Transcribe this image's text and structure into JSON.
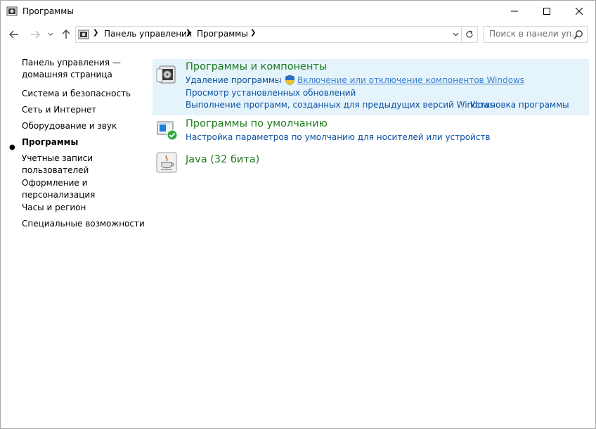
{
  "window": {
    "title": "Программы"
  },
  "navigation": {
    "breadcrumb": [
      "Панель управления",
      "Программы"
    ],
    "search_placeholder": "Поиск в панели уп..."
  },
  "sidebar": {
    "home_label": "Панель управления — домашняя страница",
    "home_line1": "Панель управления —",
    "home_line2": "домашняя страница",
    "items": [
      {
        "label": "Система и безопасность"
      },
      {
        "label": "Сеть и Интернет"
      },
      {
        "label": "Оборудование и звук"
      },
      {
        "label": "Программы",
        "current": true
      },
      {
        "label_line1": "Учетные записи",
        "label_line2": "пользователей"
      },
      {
        "label_line1": "Оформление и",
        "label_line2": "персонализация"
      },
      {
        "label": "Часы и регион"
      },
      {
        "label": "Специальные возможности"
      }
    ]
  },
  "categories": [
    {
      "title": "Программы и компоненты",
      "links": [
        "Удаление программы",
        "Включение или отключение компонентов Windows",
        "Просмотр установленных обновлений",
        "Выполнение программ, созданных для предыдущих версий Windows",
        "Установка программы"
      ],
      "icons": [
        "programs-icon",
        "uac-shield-icon"
      ]
    },
    {
      "title": "Программы по умолчанию",
      "links": [
        "Настройка параметров по умолчанию для носителей или устройств"
      ],
      "icons": [
        "default-programs-icon"
      ]
    },
    {
      "title": "Java (32 бита)",
      "links": [],
      "icons": [
        "java-icon"
      ]
    }
  ],
  "colors": {
    "category_title": "#1e7b1e",
    "link": "#0a50a0",
    "selected_background": "#e5f3fb"
  }
}
